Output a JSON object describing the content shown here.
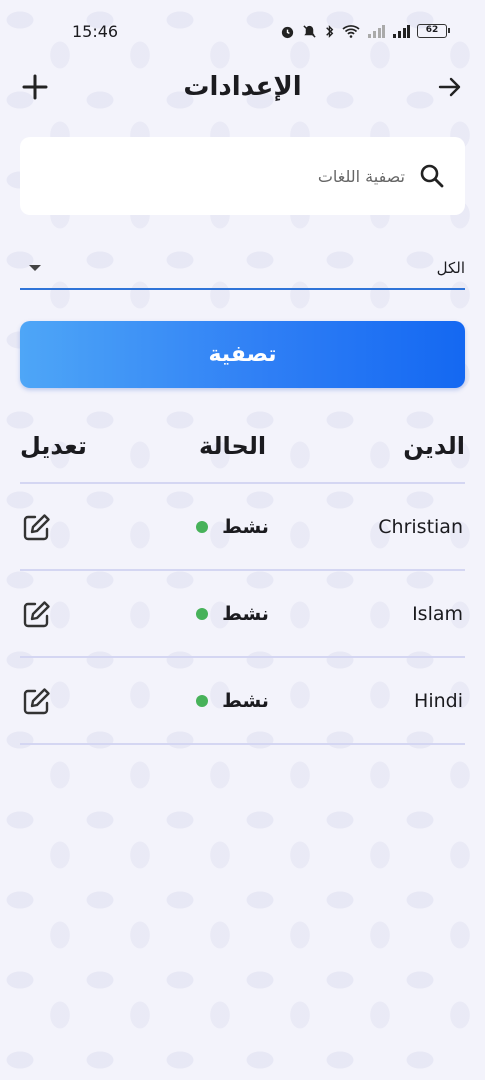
{
  "status_bar": {
    "time": "15:46",
    "battery": "62",
    "icons": [
      "alarm-icon",
      "mute-icon",
      "bluetooth-icon",
      "wifi-icon",
      "signal-icon",
      "signal-icon",
      "battery-icon"
    ]
  },
  "header": {
    "title": "الإعدادات",
    "left_icon": "plus-icon",
    "right_icon": "arrow-right-icon"
  },
  "search": {
    "placeholder": "تصفية اللغات",
    "icon": "search-icon"
  },
  "dropdown": {
    "selected": "الكل",
    "icon": "caret-down-icon"
  },
  "filter_button": {
    "label": "تصفية"
  },
  "table": {
    "headers": {
      "religion": "الدين",
      "status": "الحالة",
      "edit": "تعديل"
    },
    "rows": [
      {
        "name": "Christian",
        "status": "نشط"
      },
      {
        "name": "Islam",
        "status": "نشط"
      },
      {
        "name": "Hindi",
        "status": "نشط"
      }
    ]
  },
  "colors": {
    "accent": "#2f74d8",
    "button_gradient_start": "#4ea6f7",
    "button_gradient_end": "#1468f2",
    "active_dot": "#47b25a",
    "divider": "#d4d6f2"
  }
}
